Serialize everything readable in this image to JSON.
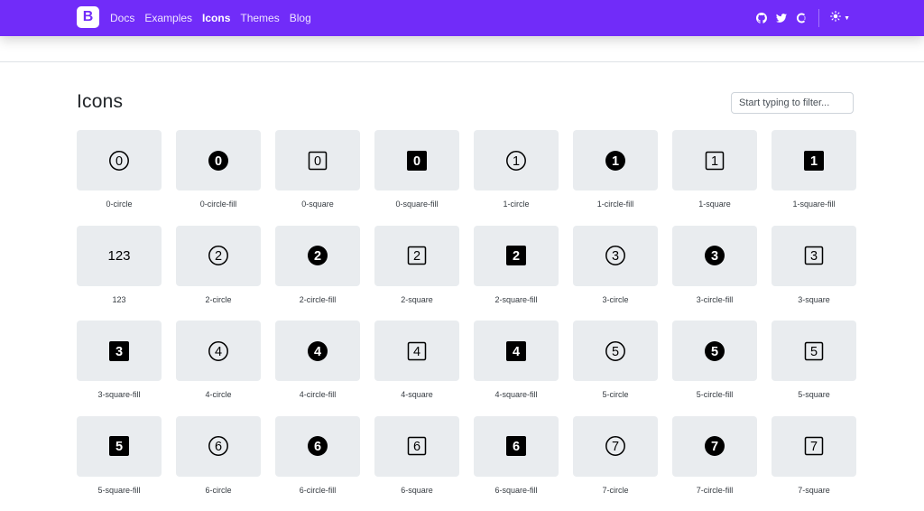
{
  "nav": {
    "brand": "B",
    "links": [
      {
        "label": "Docs",
        "active": false
      },
      {
        "label": "Examples",
        "active": false
      },
      {
        "label": "Icons",
        "active": true
      },
      {
        "label": "Themes",
        "active": false
      },
      {
        "label": "Blog",
        "active": false
      }
    ],
    "right_icons": [
      "github-icon",
      "twitter-icon",
      "opencollective-icon"
    ],
    "theme_icon": "sun-icon",
    "colors": {
      "navbar": "#712cf9",
      "tile": "#e9ecef"
    }
  },
  "page": {
    "title": "Icons",
    "filter_placeholder": "Start typing to filter..."
  },
  "icons": [
    {
      "name": "0-circle",
      "digit": "0",
      "shape": "circle",
      "fill": false
    },
    {
      "name": "0-circle-fill",
      "digit": "0",
      "shape": "circle",
      "fill": true
    },
    {
      "name": "0-square",
      "digit": "0",
      "shape": "square",
      "fill": false
    },
    {
      "name": "0-square-fill",
      "digit": "0",
      "shape": "square",
      "fill": true
    },
    {
      "name": "1-circle",
      "digit": "1",
      "shape": "circle",
      "fill": false
    },
    {
      "name": "1-circle-fill",
      "digit": "1",
      "shape": "circle",
      "fill": true
    },
    {
      "name": "1-square",
      "digit": "1",
      "shape": "square",
      "fill": false
    },
    {
      "name": "1-square-fill",
      "digit": "1",
      "shape": "square",
      "fill": true
    },
    {
      "name": "123",
      "digit": "123",
      "shape": "text",
      "fill": false
    },
    {
      "name": "2-circle",
      "digit": "2",
      "shape": "circle",
      "fill": false
    },
    {
      "name": "2-circle-fill",
      "digit": "2",
      "shape": "circle",
      "fill": true
    },
    {
      "name": "2-square",
      "digit": "2",
      "shape": "square",
      "fill": false
    },
    {
      "name": "2-square-fill",
      "digit": "2",
      "shape": "square",
      "fill": true
    },
    {
      "name": "3-circle",
      "digit": "3",
      "shape": "circle",
      "fill": false
    },
    {
      "name": "3-circle-fill",
      "digit": "3",
      "shape": "circle",
      "fill": true
    },
    {
      "name": "3-square",
      "digit": "3",
      "shape": "square",
      "fill": false
    },
    {
      "name": "3-square-fill",
      "digit": "3",
      "shape": "square",
      "fill": true
    },
    {
      "name": "4-circle",
      "digit": "4",
      "shape": "circle",
      "fill": false
    },
    {
      "name": "4-circle-fill",
      "digit": "4",
      "shape": "circle",
      "fill": true
    },
    {
      "name": "4-square",
      "digit": "4",
      "shape": "square",
      "fill": false
    },
    {
      "name": "4-square-fill",
      "digit": "4",
      "shape": "square",
      "fill": true
    },
    {
      "name": "5-circle",
      "digit": "5",
      "shape": "circle",
      "fill": false
    },
    {
      "name": "5-circle-fill",
      "digit": "5",
      "shape": "circle",
      "fill": true
    },
    {
      "name": "5-square",
      "digit": "5",
      "shape": "square",
      "fill": false
    },
    {
      "name": "5-square-fill",
      "digit": "5",
      "shape": "square",
      "fill": true
    },
    {
      "name": "6-circle",
      "digit": "6",
      "shape": "circle",
      "fill": false
    },
    {
      "name": "6-circle-fill",
      "digit": "6",
      "shape": "circle",
      "fill": true
    },
    {
      "name": "6-square",
      "digit": "6",
      "shape": "square",
      "fill": false
    },
    {
      "name": "6-square-fill",
      "digit": "6",
      "shape": "square",
      "fill": true
    },
    {
      "name": "7-circle",
      "digit": "7",
      "shape": "circle",
      "fill": false
    },
    {
      "name": "7-circle-fill",
      "digit": "7",
      "shape": "circle",
      "fill": true
    },
    {
      "name": "7-square",
      "digit": "7",
      "shape": "square",
      "fill": false
    }
  ]
}
